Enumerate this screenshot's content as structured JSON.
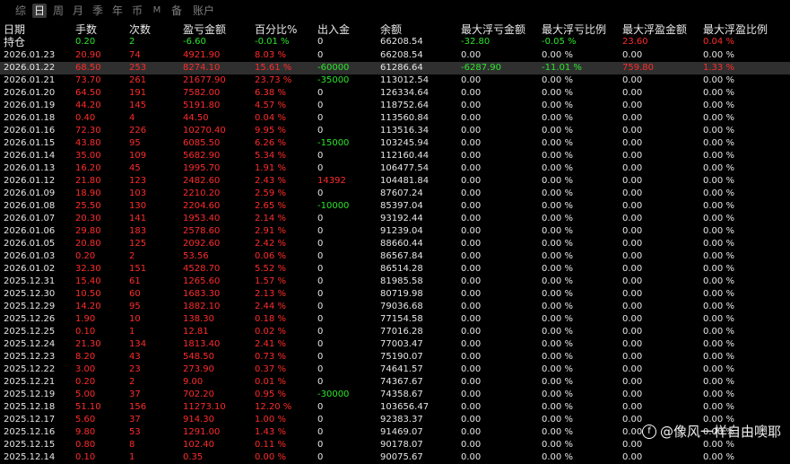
{
  "tabs": [
    {
      "label": "综",
      "active": false
    },
    {
      "label": "日",
      "active": true
    },
    {
      "label": "周",
      "active": false
    },
    {
      "label": "月",
      "active": false
    },
    {
      "label": "季",
      "active": false
    },
    {
      "label": "年",
      "active": false
    },
    {
      "label": "币",
      "active": false
    },
    {
      "label": "M",
      "active": false
    },
    {
      "label": "备",
      "active": false
    },
    {
      "label": "账户",
      "active": false
    }
  ],
  "columns": {
    "date": "日期",
    "lots": "手数",
    "count": "次数",
    "pnl": "盈亏金额",
    "pct": "百分比%",
    "inout": "出入金",
    "balance": "余额",
    "max_float_loss": "最大浮亏金额",
    "max_float_loss_pct": "最大浮亏比例",
    "max_float_profit": "最大浮盈金额",
    "max_float_profit_pct": "最大浮盈比例"
  },
  "holding": {
    "label": "持仓",
    "lots": "0.20",
    "count": "2",
    "pnl": "-6.60",
    "pct": "-0.01 %",
    "inout": "0",
    "balance": "66208.54",
    "mfl": "-32.80",
    "mflp": "-0.05 %",
    "mfp": "23.60",
    "mfpp": "0.04 %"
  },
  "rows": [
    {
      "date": "2026.01.23",
      "lots": "20.90",
      "count": "74",
      "pnl": "4921.90",
      "pct": "8.03 %",
      "inout": "0",
      "balance": "66208.54",
      "mfl": "0.00",
      "mflp": "0.00 %",
      "mfp": "0.00",
      "mfpp": "0.00 %"
    },
    {
      "date": "2026.01.22",
      "lots": "68.50",
      "count": "253",
      "pnl": "8274.10",
      "pct": "15.61 %",
      "inout": "-60000",
      "balance": "61286.64",
      "mfl": "-6287.90",
      "mflp": "-11.01 %",
      "mfp": "759.80",
      "mfpp": "1.33 %"
    },
    {
      "date": "2026.01.21",
      "lots": "73.70",
      "count": "261",
      "pnl": "21677.90",
      "pct": "23.73 %",
      "inout": "-35000",
      "balance": "113012.54",
      "mfl": "0.00",
      "mflp": "0.00 %",
      "mfp": "0.00",
      "mfpp": "0.00 %"
    },
    {
      "date": "2026.01.20",
      "lots": "64.50",
      "count": "191",
      "pnl": "7582.00",
      "pct": "6.38 %",
      "inout": "0",
      "balance": "126334.64",
      "mfl": "0.00",
      "mflp": "0.00 %",
      "mfp": "0.00",
      "mfpp": "0.00 %"
    },
    {
      "date": "2026.01.19",
      "lots": "44.20",
      "count": "145",
      "pnl": "5191.80",
      "pct": "4.57 %",
      "inout": "0",
      "balance": "118752.64",
      "mfl": "0.00",
      "mflp": "0.00 %",
      "mfp": "0.00",
      "mfpp": "0.00 %"
    },
    {
      "date": "2026.01.18",
      "lots": "0.40",
      "count": "4",
      "pnl": "44.50",
      "pct": "0.04 %",
      "inout": "0",
      "balance": "113560.84",
      "mfl": "0.00",
      "mflp": "0.00 %",
      "mfp": "0.00",
      "mfpp": "0.00 %"
    },
    {
      "date": "2026.01.16",
      "lots": "72.30",
      "count": "226",
      "pnl": "10270.40",
      "pct": "9.95 %",
      "inout": "0",
      "balance": "113516.34",
      "mfl": "0.00",
      "mflp": "0.00 %",
      "mfp": "0.00",
      "mfpp": "0.00 %"
    },
    {
      "date": "2026.01.15",
      "lots": "43.80",
      "count": "95",
      "pnl": "6085.50",
      "pct": "6.26 %",
      "inout": "-15000",
      "balance": "103245.94",
      "mfl": "0.00",
      "mflp": "0.00 %",
      "mfp": "0.00",
      "mfpp": "0.00 %"
    },
    {
      "date": "2026.01.14",
      "lots": "35.00",
      "count": "109",
      "pnl": "5682.90",
      "pct": "5.34 %",
      "inout": "0",
      "balance": "112160.44",
      "mfl": "0.00",
      "mflp": "0.00 %",
      "mfp": "0.00",
      "mfpp": "0.00 %"
    },
    {
      "date": "2026.01.13",
      "lots": "16.20",
      "count": "45",
      "pnl": "1995.70",
      "pct": "1.91 %",
      "inout": "0",
      "balance": "106477.54",
      "mfl": "0.00",
      "mflp": "0.00 %",
      "mfp": "0.00",
      "mfpp": "0.00 %"
    },
    {
      "date": "2026.01.12",
      "lots": "21.80",
      "count": "123",
      "pnl": "2482.60",
      "pct": "2.43 %",
      "inout": "14392",
      "balance": "104481.84",
      "mfl": "0.00",
      "mflp": "0.00 %",
      "mfp": "0.00",
      "mfpp": "0.00 %"
    },
    {
      "date": "2026.01.09",
      "lots": "18.90",
      "count": "103",
      "pnl": "2210.20",
      "pct": "2.59 %",
      "inout": "0",
      "balance": "87607.24",
      "mfl": "0.00",
      "mflp": "0.00 %",
      "mfp": "0.00",
      "mfpp": "0.00 %"
    },
    {
      "date": "2026.01.08",
      "lots": "25.50",
      "count": "130",
      "pnl": "2204.60",
      "pct": "2.65 %",
      "inout": "-10000",
      "balance": "85397.04",
      "mfl": "0.00",
      "mflp": "0.00 %",
      "mfp": "0.00",
      "mfpp": "0.00 %"
    },
    {
      "date": "2026.01.07",
      "lots": "20.30",
      "count": "141",
      "pnl": "1953.40",
      "pct": "2.14 %",
      "inout": "0",
      "balance": "93192.44",
      "mfl": "0.00",
      "mflp": "0.00 %",
      "mfp": "0.00",
      "mfpp": "0.00 %"
    },
    {
      "date": "2026.01.06",
      "lots": "29.80",
      "count": "183",
      "pnl": "2578.60",
      "pct": "2.91 %",
      "inout": "0",
      "balance": "91239.04",
      "mfl": "0.00",
      "mflp": "0.00 %",
      "mfp": "0.00",
      "mfpp": "0.00 %"
    },
    {
      "date": "2026.01.05",
      "lots": "20.80",
      "count": "125",
      "pnl": "2092.60",
      "pct": "2.42 %",
      "inout": "0",
      "balance": "88660.44",
      "mfl": "0.00",
      "mflp": "0.00 %",
      "mfp": "0.00",
      "mfpp": "0.00 %"
    },
    {
      "date": "2026.01.03",
      "lots": "0.20",
      "count": "2",
      "pnl": "53.56",
      "pct": "0.06 %",
      "inout": "0",
      "balance": "86567.84",
      "mfl": "0.00",
      "mflp": "0.00 %",
      "mfp": "0.00",
      "mfpp": "0.00 %"
    },
    {
      "date": "2026.01.02",
      "lots": "32.30",
      "count": "151",
      "pnl": "4528.70",
      "pct": "5.52 %",
      "inout": "0",
      "balance": "86514.28",
      "mfl": "0.00",
      "mflp": "0.00 %",
      "mfp": "0.00",
      "mfpp": "0.00 %"
    },
    {
      "date": "2025.12.31",
      "lots": "15.40",
      "count": "61",
      "pnl": "1265.60",
      "pct": "1.57 %",
      "inout": "0",
      "balance": "81985.58",
      "mfl": "0.00",
      "mflp": "0.00 %",
      "mfp": "0.00",
      "mfpp": "0.00 %"
    },
    {
      "date": "2025.12.30",
      "lots": "10.50",
      "count": "60",
      "pnl": "1683.30",
      "pct": "2.13 %",
      "inout": "0",
      "balance": "80719.98",
      "mfl": "0.00",
      "mflp": "0.00 %",
      "mfp": "0.00",
      "mfpp": "0.00 %"
    },
    {
      "date": "2025.12.29",
      "lots": "14.20",
      "count": "95",
      "pnl": "1882.10",
      "pct": "2.44 %",
      "inout": "0",
      "balance": "79036.68",
      "mfl": "0.00",
      "mflp": "0.00 %",
      "mfp": "0.00",
      "mfpp": "0.00 %"
    },
    {
      "date": "2025.12.26",
      "lots": "1.90",
      "count": "10",
      "pnl": "138.30",
      "pct": "0.18 %",
      "inout": "0",
      "balance": "77154.58",
      "mfl": "0.00",
      "mflp": "0.00 %",
      "mfp": "0.00",
      "mfpp": "0.00 %"
    },
    {
      "date": "2025.12.25",
      "lots": "0.10",
      "count": "1",
      "pnl": "12.81",
      "pct": "0.02 %",
      "inout": "0",
      "balance": "77016.28",
      "mfl": "0.00",
      "mflp": "0.00 %",
      "mfp": "0.00",
      "mfpp": "0.00 %"
    },
    {
      "date": "2025.12.24",
      "lots": "21.30",
      "count": "134",
      "pnl": "1813.40",
      "pct": "2.41 %",
      "inout": "0",
      "balance": "77003.47",
      "mfl": "0.00",
      "mflp": "0.00 %",
      "mfp": "0.00",
      "mfpp": "0.00 %"
    },
    {
      "date": "2025.12.23",
      "lots": "8.20",
      "count": "43",
      "pnl": "548.50",
      "pct": "0.73 %",
      "inout": "0",
      "balance": "75190.07",
      "mfl": "0.00",
      "mflp": "0.00 %",
      "mfp": "0.00",
      "mfpp": "0.00 %"
    },
    {
      "date": "2025.12.22",
      "lots": "3.00",
      "count": "23",
      "pnl": "273.90",
      "pct": "0.37 %",
      "inout": "0",
      "balance": "74641.57",
      "mfl": "0.00",
      "mflp": "0.00 %",
      "mfp": "0.00",
      "mfpp": "0.00 %"
    },
    {
      "date": "2025.12.21",
      "lots": "0.20",
      "count": "2",
      "pnl": "9.00",
      "pct": "0.01 %",
      "inout": "0",
      "balance": "74367.67",
      "mfl": "0.00",
      "mflp": "0.00 %",
      "mfp": "0.00",
      "mfpp": "0.00 %"
    },
    {
      "date": "2025.12.19",
      "lots": "5.00",
      "count": "37",
      "pnl": "702.20",
      "pct": "0.95 %",
      "inout": "-30000",
      "balance": "74358.67",
      "mfl": "0.00",
      "mflp": "0.00 %",
      "mfp": "0.00",
      "mfpp": "0.00 %"
    },
    {
      "date": "2025.12.18",
      "lots": "51.10",
      "count": "156",
      "pnl": "11273.10",
      "pct": "12.20 %",
      "inout": "0",
      "balance": "103656.47",
      "mfl": "0.00",
      "mflp": "0.00 %",
      "mfp": "0.00",
      "mfpp": "0.00 %"
    },
    {
      "date": "2025.12.17",
      "lots": "5.60",
      "count": "37",
      "pnl": "914.30",
      "pct": "1.00 %",
      "inout": "0",
      "balance": "92383.37",
      "mfl": "0.00",
      "mflp": "0.00 %",
      "mfp": "0.00",
      "mfpp": "0.00 %"
    },
    {
      "date": "2025.12.16",
      "lots": "9.80",
      "count": "53",
      "pnl": "1291.00",
      "pct": "1.43 %",
      "inout": "0",
      "balance": "91469.07",
      "mfl": "0.00",
      "mflp": "0.00 %",
      "mfp": "0.00",
      "mfpp": "0.00 %"
    },
    {
      "date": "2025.12.15",
      "lots": "0.80",
      "count": "8",
      "pnl": "102.40",
      "pct": "0.11 %",
      "inout": "0",
      "balance": "90178.07",
      "mfl": "0.00",
      "mflp": "0.00 %",
      "mfp": "0.00",
      "mfpp": "0.00 %"
    },
    {
      "date": "2025.12.14",
      "lots": "0.10",
      "count": "1",
      "pnl": "0.35",
      "pct": "0.00 %",
      "inout": "0",
      "balance": "90075.67",
      "mfl": "0.00",
      "mflp": "0.00 %",
      "mfp": "0.00",
      "mfpp": "0.00 %"
    }
  ],
  "watermark": "@像风一样自由噢耶",
  "colors": {
    "background": "#000000",
    "profit": "#ff2b2b",
    "loss": "#2be52b",
    "text": "#e6e6e6",
    "header": "#e8e8e8"
  }
}
